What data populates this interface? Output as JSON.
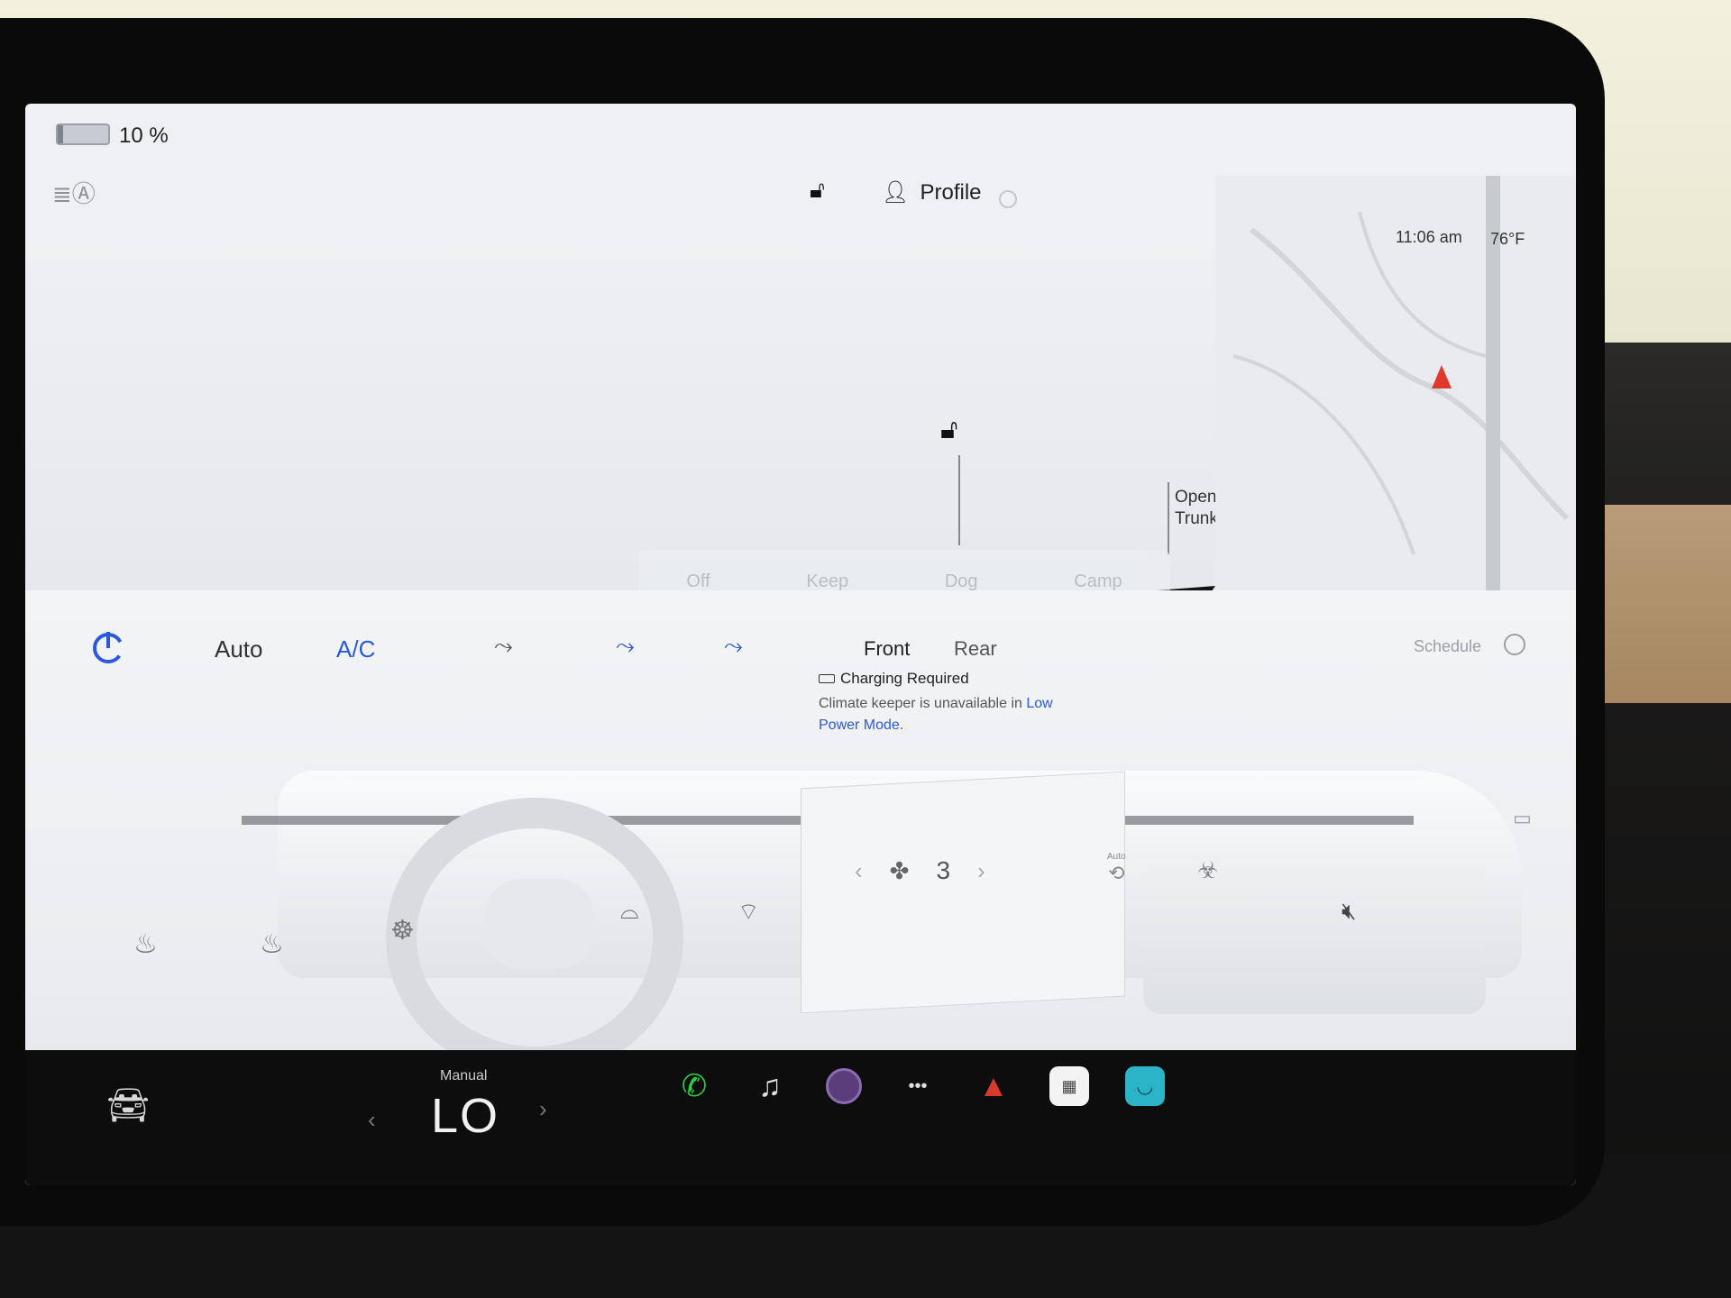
{
  "status": {
    "battery_percent": "10 %",
    "battery_level": 0.1,
    "profile_label": "Profile",
    "clock": "11:06 am",
    "outside_temp": "76°F"
  },
  "car": {
    "open_trunk": "Open\nTrunk"
  },
  "climate_keeper": {
    "options": [
      "Off",
      "Keep",
      "Dog",
      "Camp"
    ]
  },
  "climate": {
    "auto_label": "Auto",
    "ac_label": "A/C",
    "front_label": "Front",
    "rear_label": "Rear",
    "schedule_label": "Schedule",
    "fan_speed": "3",
    "recirc_label": "Auto"
  },
  "toast": {
    "title": "Charging Required",
    "body": "Climate keeper is unavailable in ",
    "link": "Low Power Mode",
    "end": "."
  },
  "dock": {
    "temp_mode": "Manual",
    "temp_value": "LO"
  },
  "icons": {
    "phone": "phone-icon",
    "music": "music-icon",
    "camera": "camera-icon",
    "more": "more-icon",
    "nav": "navigation-icon",
    "calendar": "calendar-icon",
    "toybox": "toybox-icon"
  },
  "colors": {
    "accent": "#2b59d9",
    "phone": "#2ecc40",
    "nav_arrow": "#e03a2e"
  }
}
